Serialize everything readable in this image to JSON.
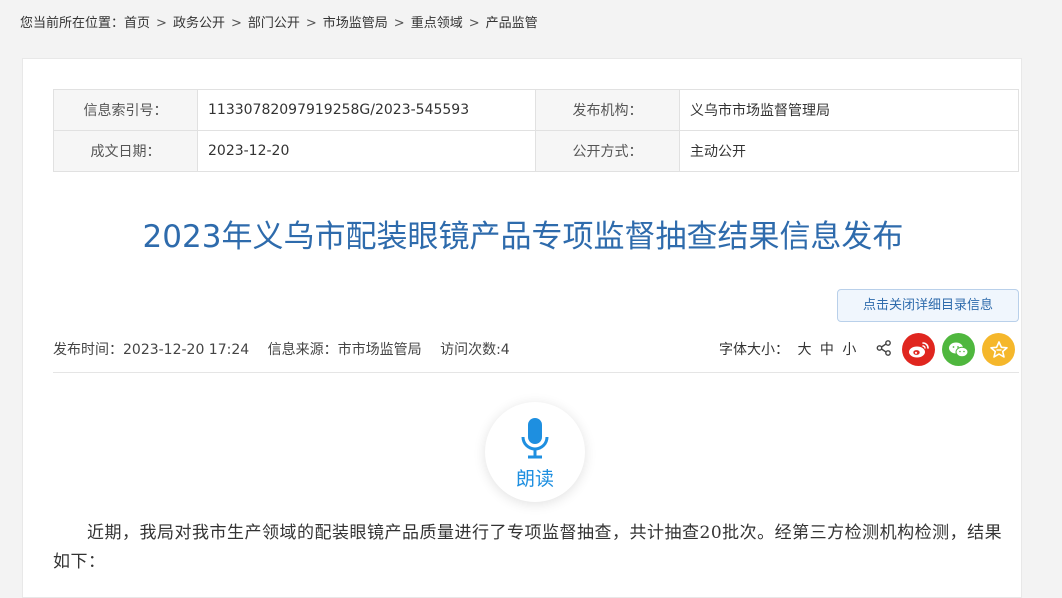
{
  "breadcrumb": {
    "prefix": "您当前所在位置：",
    "items": [
      "首页",
      "政务公开",
      "部门公开",
      "市场监管局",
      "重点领域",
      "产品监管"
    ]
  },
  "meta": {
    "index_label": "信息索引号：",
    "index_value": "11330782097919258G/2023-545593",
    "org_label": "发布机构：",
    "org_value": "义乌市市场监督管理局",
    "date_label": "成文日期：",
    "date_value": "2023-12-20",
    "mode_label": "公开方式：",
    "mode_value": "主动公开"
  },
  "article": {
    "title": "2023年义乌市配装眼镜产品专项监督抽查结果信息发布",
    "toggle_label": "点击关闭详细目录信息",
    "publish_time": "发布时间：2023-12-20 17:24",
    "source": "信息来源：市市场监管局",
    "visits": "访问次数:4",
    "font_size_label": "字体大小：",
    "font_large": "大",
    "font_medium": "中",
    "font_small": "小",
    "read_label": "朗读",
    "body": "近期，我局对我市生产领域的配装眼镜产品质量进行了专项监督抽查，共计抽查20批次。经第三方检测机构检测，结果如下："
  },
  "colors": {
    "title": "#2e6bac",
    "weibo": "#e0261f",
    "wechat": "#4fb73e",
    "favorite": "#f5b72b",
    "read": "#1e8fe0"
  },
  "icons": [
    "share-icon",
    "weibo-icon",
    "wechat-icon",
    "star-icon",
    "microphone-icon"
  ]
}
